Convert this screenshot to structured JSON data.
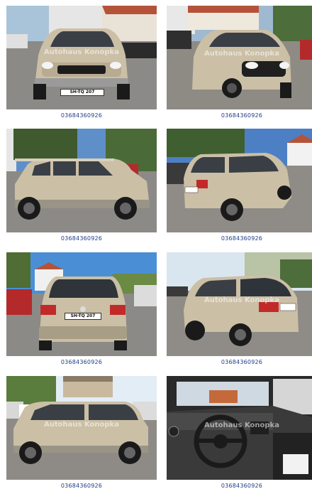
{
  "gallery": {
    "photos": [
      {
        "caption": "03684360926",
        "watermark": "Autohaus Konopka",
        "plate": "SH-TQ 207"
      },
      {
        "caption": "03684360926",
        "watermark": "Autohaus Konopka",
        "plate": ""
      },
      {
        "caption": "03684360926",
        "watermark": "",
        "plate": ""
      },
      {
        "caption": "03684360926",
        "watermark": "",
        "plate": ""
      },
      {
        "caption": "03684360926",
        "watermark": "",
        "plate": "SH-TQ 207"
      },
      {
        "caption": "03684360926",
        "watermark": "Autohaus Konopka",
        "plate": ""
      },
      {
        "caption": "03684360926",
        "watermark": "Autohaus Konopka",
        "plate": ""
      },
      {
        "caption": "03684360926",
        "watermark": "Autohaus Konopka",
        "plate": ""
      }
    ]
  },
  "colors": {
    "caption": "#1f3c88",
    "car_body": "#cbbfa6",
    "sky": "#4a8fd6"
  }
}
